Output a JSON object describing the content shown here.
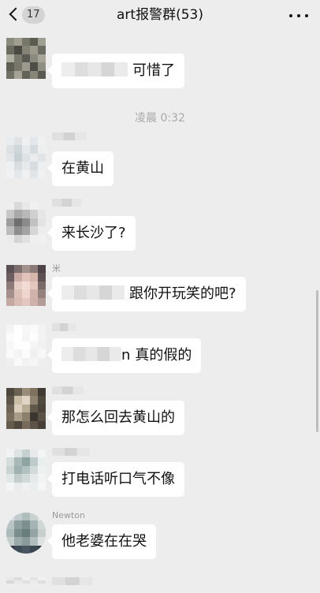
{
  "header": {
    "back_count": "17",
    "title": "art报警群(53)"
  },
  "timestamp": "凌晨 0:32",
  "messages": [
    {
      "text": "可惜了"
    },
    {
      "text": "在黄山"
    },
    {
      "text": "来长沙了?"
    },
    {
      "sender": "米",
      "text": "跟你开玩笑的吧?"
    },
    {
      "partial": "n",
      "text": "真的假的"
    },
    {
      "text": "那怎么回去黄山的"
    },
    {
      "text": "打电话听口气不像"
    },
    {
      "sender": "Newton",
      "text": "他老婆在在哭"
    }
  ]
}
